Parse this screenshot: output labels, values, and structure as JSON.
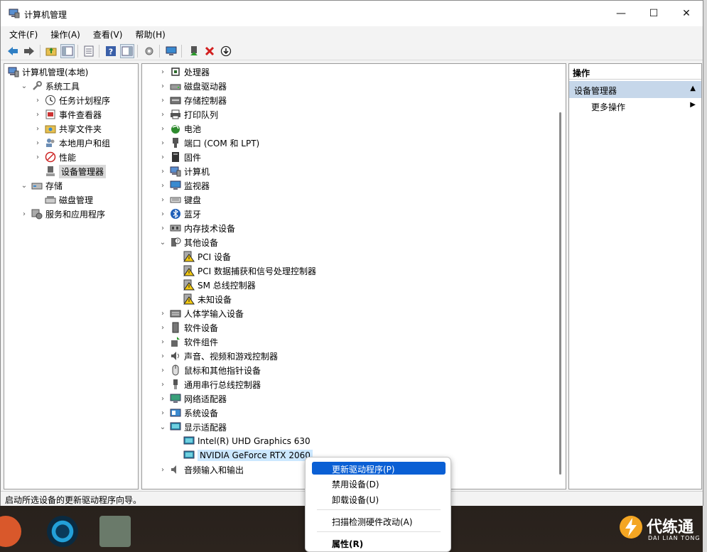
{
  "window": {
    "title": "计算机管理",
    "minimize": "—",
    "maximize": "☐",
    "close": "✕"
  },
  "menu": [
    "文件(F)",
    "操作(A)",
    "查看(V)",
    "帮助(H)"
  ],
  "left_tree": [
    {
      "label": "计算机管理(本地)",
      "depth": 0,
      "chev": ""
    },
    {
      "label": "系统工具",
      "depth": 1,
      "chev": "v"
    },
    {
      "label": "任务计划程序",
      "depth": 2,
      "chev": ">"
    },
    {
      "label": "事件查看器",
      "depth": 2,
      "chev": ">"
    },
    {
      "label": "共享文件夹",
      "depth": 2,
      "chev": ">"
    },
    {
      "label": "本地用户和组",
      "depth": 2,
      "chev": ">"
    },
    {
      "label": "性能",
      "depth": 2,
      "chev": ">"
    },
    {
      "label": "设备管理器",
      "depth": 2,
      "chev": ""
    },
    {
      "label": "存储",
      "depth": 1,
      "chev": "v"
    },
    {
      "label": "磁盘管理",
      "depth": 2,
      "chev": ""
    },
    {
      "label": "服务和应用程序",
      "depth": 1,
      "chev": ">"
    }
  ],
  "device_tree": [
    {
      "label": "处理器",
      "depth": 0,
      "chev": ">"
    },
    {
      "label": "磁盘驱动器",
      "depth": 0,
      "chev": ">"
    },
    {
      "label": "存储控制器",
      "depth": 0,
      "chev": ">"
    },
    {
      "label": "打印队列",
      "depth": 0,
      "chev": ">"
    },
    {
      "label": "电池",
      "depth": 0,
      "chev": ">"
    },
    {
      "label": "端口 (COM 和 LPT)",
      "depth": 0,
      "chev": ">"
    },
    {
      "label": "固件",
      "depth": 0,
      "chev": ">"
    },
    {
      "label": "计算机",
      "depth": 0,
      "chev": ">"
    },
    {
      "label": "监视器",
      "depth": 0,
      "chev": ">"
    },
    {
      "label": "键盘",
      "depth": 0,
      "chev": ">"
    },
    {
      "label": "蓝牙",
      "depth": 0,
      "chev": ">"
    },
    {
      "label": "内存技术设备",
      "depth": 0,
      "chev": ">"
    },
    {
      "label": "其他设备",
      "depth": 0,
      "chev": "v"
    },
    {
      "label": "PCI 设备",
      "depth": 1,
      "chev": ""
    },
    {
      "label": "PCI 数据捕获和信号处理控制器",
      "depth": 1,
      "chev": ""
    },
    {
      "label": "SM 总线控制器",
      "depth": 1,
      "chev": ""
    },
    {
      "label": "未知设备",
      "depth": 1,
      "chev": ""
    },
    {
      "label": "人体学输入设备",
      "depth": 0,
      "chev": ">"
    },
    {
      "label": "软件设备",
      "depth": 0,
      "chev": ">"
    },
    {
      "label": "软件组件",
      "depth": 0,
      "chev": ">"
    },
    {
      "label": "声音、视频和游戏控制器",
      "depth": 0,
      "chev": ">"
    },
    {
      "label": "鼠标和其他指针设备",
      "depth": 0,
      "chev": ">"
    },
    {
      "label": "通用串行总线控制器",
      "depth": 0,
      "chev": ">"
    },
    {
      "label": "网络适配器",
      "depth": 0,
      "chev": ">"
    },
    {
      "label": "系统设备",
      "depth": 0,
      "chev": ">"
    },
    {
      "label": "显示适配器",
      "depth": 0,
      "chev": "v"
    },
    {
      "label": "Intel(R) UHD Graphics 630",
      "depth": 1,
      "chev": ""
    },
    {
      "label": "NVIDIA GeForce RTX 2060",
      "depth": 1,
      "chev": ""
    },
    {
      "label": "音频输入和输出",
      "depth": 0,
      "chev": ">"
    }
  ],
  "actions": {
    "header": "操作",
    "section": "设备管理器",
    "more": "更多操作"
  },
  "status": "启动所选设备的更新驱动程序向导。",
  "context_menu": [
    "更新驱动程序(P)",
    "禁用设备(D)",
    "卸载设备(U)",
    "扫描检测硬件改动(A)",
    "属性(R)"
  ],
  "watermark": {
    "title": "代练通",
    "subtitle": "DAI LIAN TONG"
  },
  "colors": {
    "accent": "#0a5fd4",
    "selection": "#cce8ff",
    "section": "#c6d7ea"
  }
}
